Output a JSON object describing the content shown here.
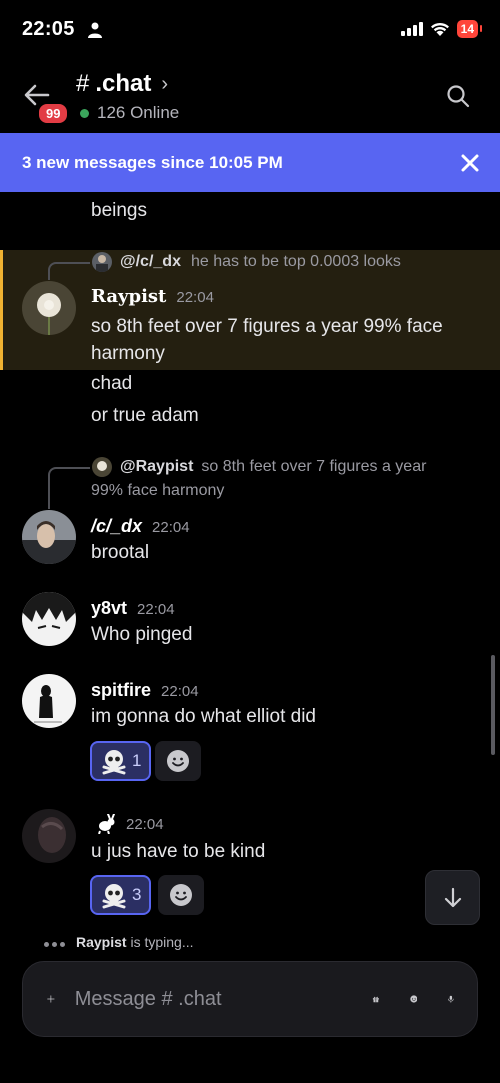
{
  "status": {
    "time": "22:05",
    "battery": "14"
  },
  "header": {
    "badge": "99",
    "hash": "#",
    "channel": ".chat",
    "online": "126 Online"
  },
  "banner": {
    "text": "3 new messages since 10:05 PM"
  },
  "messages": {
    "top_text": "beings",
    "m1": {
      "reply_name": "@/c/_dx",
      "reply_text": "he has to be  top 0.0003 looks",
      "username": "Raypist",
      "time": "22:04",
      "text": "so 8th feet over 7 figures a year 99% face harmony"
    },
    "m1_cont1": "chad",
    "m1_cont2": "or true adam",
    "m2": {
      "reply_name": "@Raypist",
      "reply_text_line1": "so 8th feet over 7 figures a year",
      "reply_text_line2": "99% face harmony",
      "username": "/c/_dx",
      "time": "22:04",
      "text": "brootal"
    },
    "m3": {
      "username": "y8vt",
      "time": "22:04",
      "text": "Who pinged"
    },
    "m4": {
      "username": "spitfire",
      "time": "22:04",
      "text": "im gonna do what elliot did",
      "reaction_icon": "skull-crossbones-icon",
      "reaction_count": "1"
    },
    "m5": {
      "time": "22:04",
      "text": "u jus have to be kind",
      "reaction_icon": "skull-crossbones-icon",
      "reaction_count": "3"
    }
  },
  "typing": {
    "name": "Raypist",
    "suffix": " is typing..."
  },
  "composer": {
    "placeholder": "Message # .chat"
  },
  "colors": {
    "accent": "#5865f2",
    "badge_red": "#e23c44",
    "online_green": "#3ba55c",
    "highlight_gold": "#f0b232"
  }
}
